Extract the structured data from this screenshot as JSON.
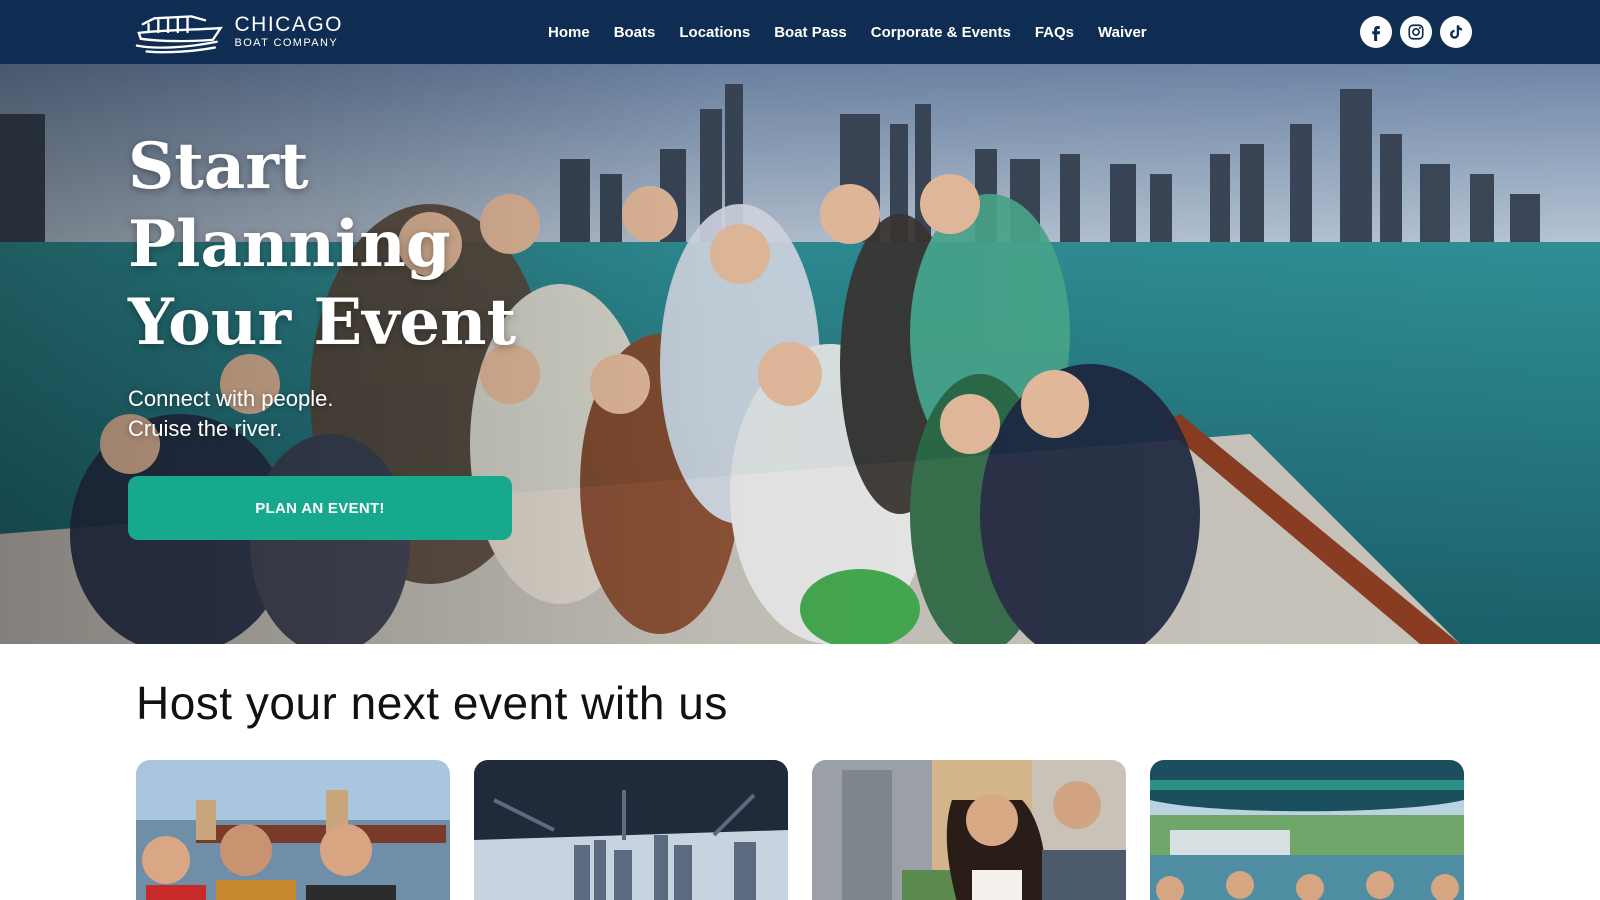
{
  "brand": {
    "name": "CHICAGO",
    "tagline": "BOAT COMPANY",
    "colors": {
      "navbar": "#0f2d52",
      "accent": "#17a98e",
      "white": "#ffffff"
    }
  },
  "nav": {
    "items": [
      {
        "label": "Home"
      },
      {
        "label": "Boats"
      },
      {
        "label": "Locations"
      },
      {
        "label": "Boat Pass"
      },
      {
        "label": "Corporate & Events"
      },
      {
        "label": "FAQs"
      },
      {
        "label": "Waiver"
      }
    ],
    "social": [
      {
        "icon": "facebook-icon"
      },
      {
        "icon": "instagram-icon"
      },
      {
        "icon": "tiktok-icon"
      }
    ]
  },
  "hero": {
    "title_lines": [
      "Start",
      "Planning",
      "Your Event"
    ],
    "subtitle_lines": [
      "Connect with people.",
      "Cruise the river."
    ],
    "cta_label": "PLAN AN EVENT!"
  },
  "events_section": {
    "title": "Host your next event with us",
    "cards": [
      {
        "image": "group-on-boat-photo"
      },
      {
        "image": "boat-canopy-skyline-photo"
      },
      {
        "image": "couple-wedding-photo"
      },
      {
        "image": "boat-party-photo"
      }
    ]
  }
}
